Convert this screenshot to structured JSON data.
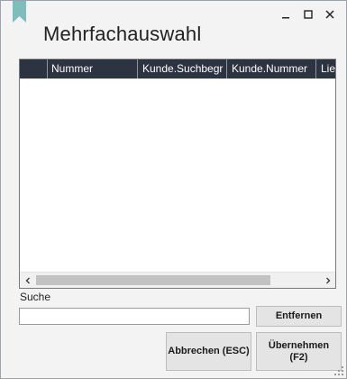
{
  "window": {
    "title": "Mehrfachauswahl",
    "accent": "#7dbdbb",
    "controls": {
      "minimize": "minimize-icon",
      "maximize": "maximize-icon",
      "close": "close-icon"
    }
  },
  "grid": {
    "header_bg": "#2b3440",
    "columns": [
      {
        "label": "Nummer"
      },
      {
        "label": "Kunde.Suchbegr"
      },
      {
        "label": "Kunde.Nummer"
      },
      {
        "label": "Liefe"
      }
    ],
    "rows": []
  },
  "search": {
    "label": "Suche",
    "value": "",
    "placeholder": ""
  },
  "buttons": {
    "remove": "Entfernen",
    "cancel": "Abbrechen (ESC)",
    "apply_line1": "Übernehmen",
    "apply_line2": "(F2)"
  }
}
